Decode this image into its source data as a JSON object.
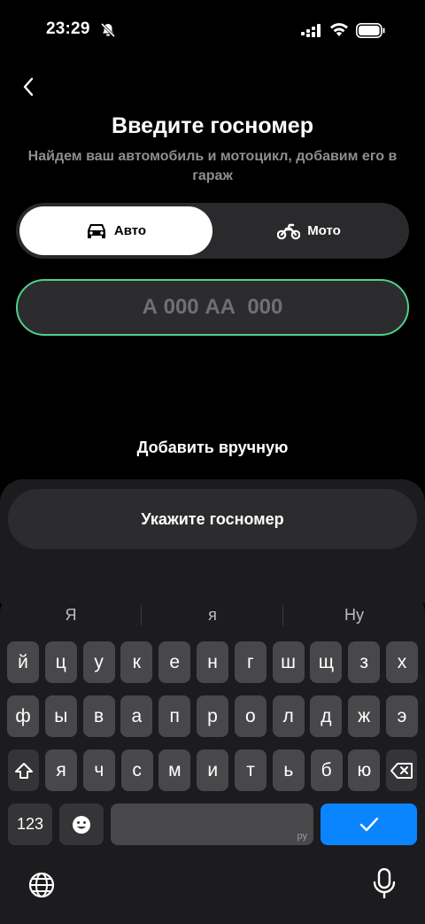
{
  "status": {
    "time": "23:29"
  },
  "header": {
    "title": "Введите госномер",
    "subtitle": "Найдем ваш автомобиль и мотоцикл, добавим его в гараж"
  },
  "segment": {
    "auto_label": "Авто",
    "moto_label": "Мото",
    "selected": "Авто"
  },
  "plate": {
    "placeholder": "А 000 АА  000",
    "value": ""
  },
  "add_manual_label": "Добавить вручную",
  "sheet": {
    "button_label": "Укажите госномер"
  },
  "keyboard": {
    "suggestions": [
      "Я",
      "я",
      "Ну"
    ],
    "row1": [
      "й",
      "ц",
      "у",
      "к",
      "е",
      "н",
      "г",
      "ш",
      "щ",
      "з",
      "х"
    ],
    "row2": [
      "ф",
      "ы",
      "в",
      "а",
      "п",
      "р",
      "о",
      "л",
      "д",
      "ж",
      "э"
    ],
    "row3": [
      "я",
      "ч",
      "с",
      "м",
      "и",
      "т",
      "ь",
      "б",
      "ю"
    ],
    "numbers_label": "123",
    "space_lang": "ру"
  },
  "colors": {
    "accent_border": "#4fd08c",
    "enter_key": "#0a84ff",
    "background": "#000000"
  }
}
